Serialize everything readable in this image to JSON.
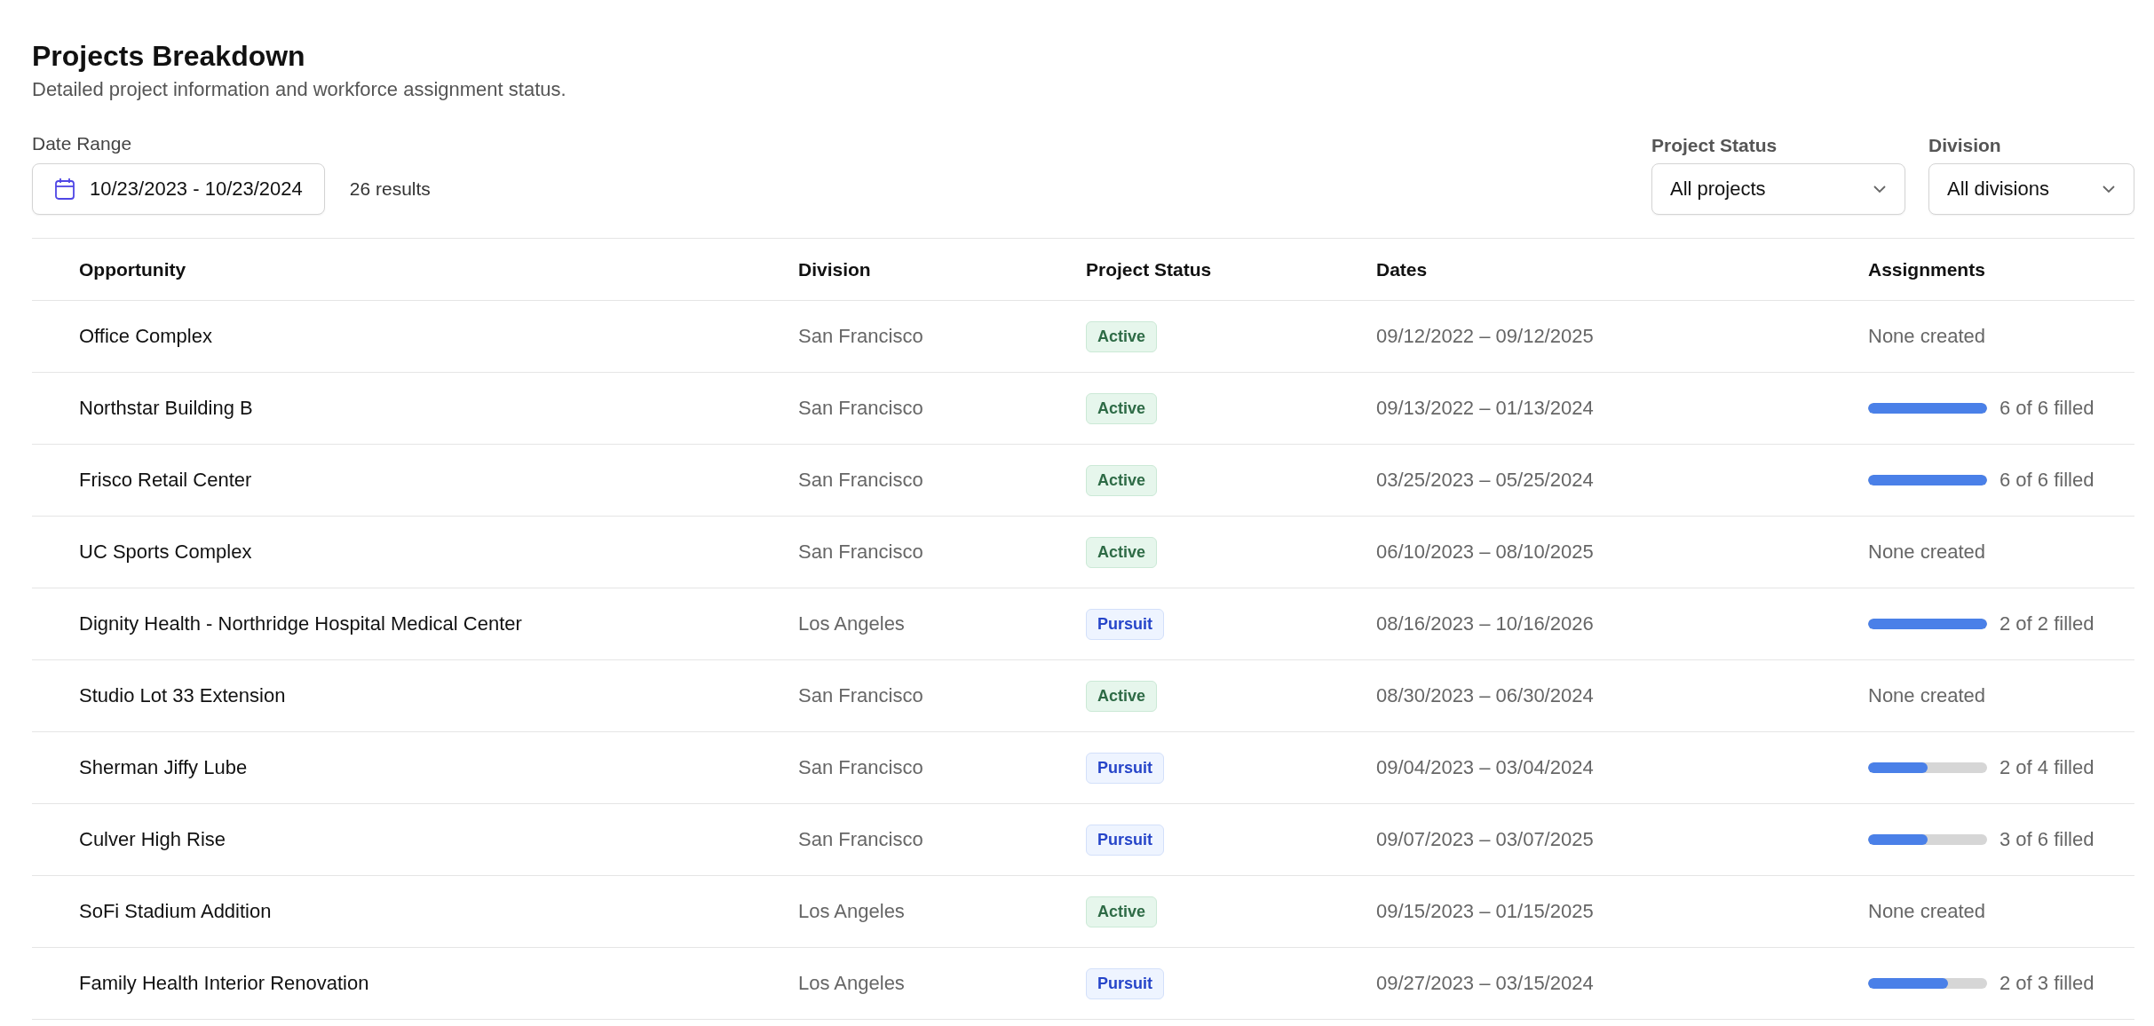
{
  "header": {
    "title": "Projects Breakdown",
    "subtitle": "Detailed project information and workforce assignment status."
  },
  "date_range": {
    "label": "Date Range",
    "value": "10/23/2023 - 10/23/2024"
  },
  "results": "26 results",
  "filters": [
    {
      "label": "Project Status",
      "value": "All projects"
    },
    {
      "label": "Division",
      "value": "All divisions"
    }
  ],
  "table": {
    "columns": [
      "Opportunity",
      "Division",
      "Project Status",
      "Dates",
      "Assignments"
    ],
    "rows": [
      {
        "opportunity": "Office Complex",
        "division": "San Francisco",
        "status": {
          "kind": "active",
          "label": "Active"
        },
        "dates": "09/12/2022 – 09/12/2025",
        "assignments": {
          "kind": "none",
          "text": "None created"
        }
      },
      {
        "opportunity": "Northstar Building B",
        "division": "San Francisco",
        "status": {
          "kind": "active",
          "label": "Active"
        },
        "dates": "09/13/2022 – 01/13/2024",
        "assignments": {
          "kind": "progress",
          "level": 1,
          "text": "6 of 6 filled"
        }
      },
      {
        "opportunity": "Frisco Retail Center",
        "division": "San Francisco",
        "status": {
          "kind": "active",
          "label": "Active"
        },
        "dates": "03/25/2023 – 05/25/2024",
        "assignments": {
          "kind": "progress",
          "level": 1,
          "text": "6 of 6 filled"
        }
      },
      {
        "opportunity": "UC Sports Complex",
        "division": "San Francisco",
        "status": {
          "kind": "active",
          "label": "Active"
        },
        "dates": "06/10/2023 – 08/10/2025",
        "assignments": {
          "kind": "none",
          "text": "None created"
        }
      },
      {
        "opportunity": "Dignity Health - Northridge Hospital Medical Center",
        "division": "Los Angeles",
        "status": {
          "kind": "pursuit",
          "label": "Pursuit"
        },
        "dates": "08/16/2023 – 10/16/2026",
        "assignments": {
          "kind": "progress",
          "level": 1,
          "text": "2 of 2 filled"
        }
      },
      {
        "opportunity": "Studio Lot 33 Extension",
        "division": "San Francisco",
        "status": {
          "kind": "active",
          "label": "Active"
        },
        "dates": "08/30/2023 – 06/30/2024",
        "assignments": {
          "kind": "none",
          "text": "None created"
        }
      },
      {
        "opportunity": "Sherman Jiffy Lube",
        "division": "San Francisco",
        "status": {
          "kind": "pursuit",
          "label": "Pursuit"
        },
        "dates": "09/04/2023 – 03/04/2024",
        "assignments": {
          "kind": "progress",
          "level": 0.5,
          "text": "2 of 4 filled"
        }
      },
      {
        "opportunity": "Culver High Rise",
        "division": "San Francisco",
        "status": {
          "kind": "pursuit",
          "label": "Pursuit"
        },
        "dates": "09/07/2023 – 03/07/2025",
        "assignments": {
          "kind": "progress",
          "level": 0.5,
          "text": "3 of 6 filled"
        }
      },
      {
        "opportunity": "SoFi Stadium Addition",
        "division": "Los Angeles",
        "status": {
          "kind": "active",
          "label": "Active"
        },
        "dates": "09/15/2023 – 01/15/2025",
        "assignments": {
          "kind": "none",
          "text": "None created"
        }
      },
      {
        "opportunity": "Family Health Interior Renovation",
        "division": "Los Angeles",
        "status": {
          "kind": "pursuit",
          "label": "Pursuit"
        },
        "dates": "09/27/2023 – 03/15/2024",
        "assignments": {
          "kind": "progress",
          "level": 0.67,
          "text": "2 of 3 filled"
        }
      }
    ]
  }
}
